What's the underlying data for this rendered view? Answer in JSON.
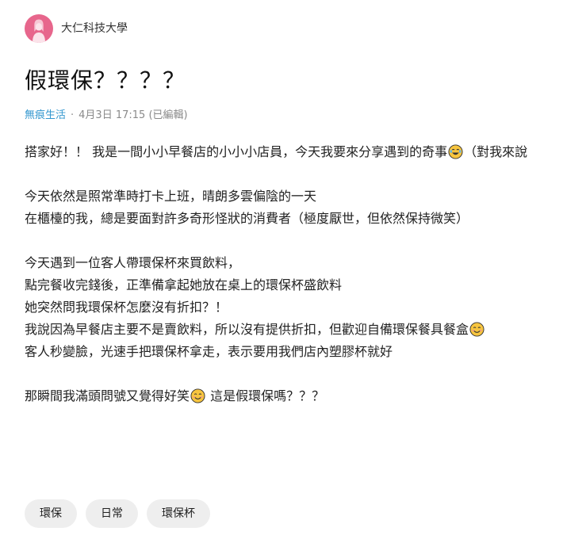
{
  "author": {
    "avatar_icon": "female-avatar-icon",
    "avatar_color": "#e7668c",
    "school": "大仁科技大學"
  },
  "post": {
    "title": "假環保？？？？",
    "forum": "無痕生活",
    "separator": "·",
    "date": "4月3日 17:15",
    "edited": "(已編輯)",
    "body": {
      "p1": {
        "text": "搭家好！！ 我是一間小小早餐店的小小小店員，今天我要來分享遇到的奇事",
        "emoji": "laughing-tears-emoji",
        "text_after": "（對我來說"
      },
      "p2": [
        "今天依然是照常準時打卡上班，晴朗多雲偏陰的一天",
        "在櫃檯的我，總是要面對許多奇形怪狀的消費者（極度厭世，但依然保持微笑）"
      ],
      "p3": {
        "l1": "今天遇到一位客人帶環保杯來買飲料，",
        "l2": "點完餐收完錢後，正準備拿起她放在桌上的環保杯盛飲料",
        "l3": "她突然問我環保杯怎麼沒有折扣？！",
        "l4": "我說因為早餐店主要不是賣飲料，所以沒有提供折扣，但歡迎自備環保餐具餐盒",
        "l4_emoji": "smiling-face-emoji",
        "l5": "客人秒變臉，光速手把環保杯拿走，表示要用我們店內塑膠杯就好"
      },
      "p4": {
        "text": "那瞬間我滿頭問號又覺得好笑",
        "emoji": "smiling-face-emoji",
        "text_after": " 這是假環保嗎？？？"
      }
    }
  },
  "tags": [
    "環保",
    "日常",
    "環保杯"
  ],
  "colors": {
    "forum_link": "#3397cf",
    "meta_text": "#8a8a8a",
    "tag_background": "#eeeeee",
    "emoji_face": "#f7c53f"
  }
}
